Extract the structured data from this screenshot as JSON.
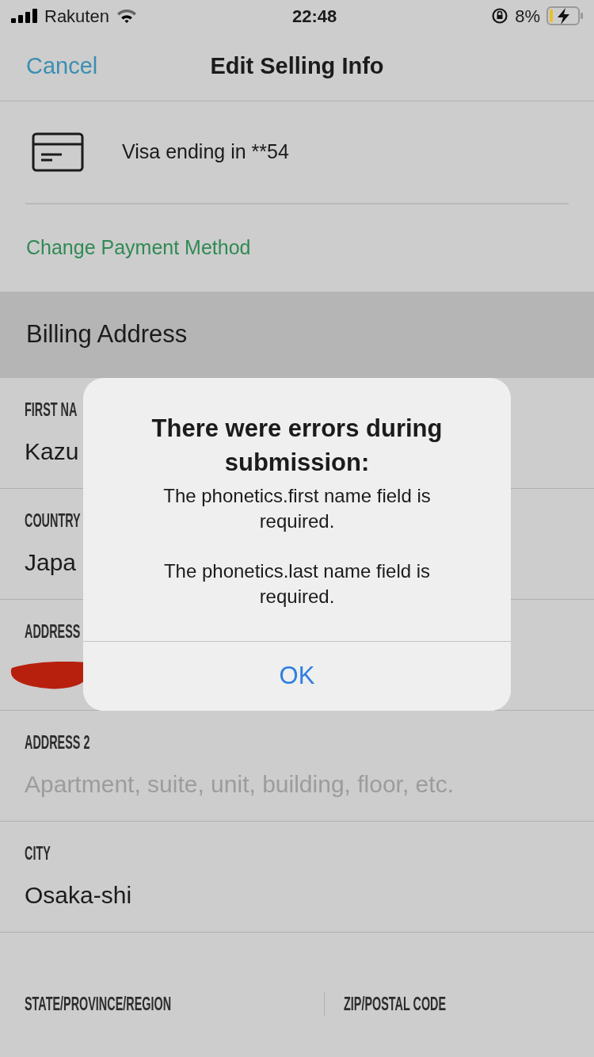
{
  "status_bar": {
    "carrier": "Rakuten",
    "time": "22:48",
    "battery": "8%"
  },
  "nav": {
    "cancel": "Cancel",
    "title": "Edit Selling Info"
  },
  "payment": {
    "card": "Visa ending in **54",
    "change_link": "Change Payment Method"
  },
  "section": {
    "title": "Billing Address"
  },
  "fields": [
    {
      "kind": "value",
      "label": "FIRST NA",
      "value": "Kazu"
    },
    {
      "kind": "value",
      "label": "COUNTRY",
      "value": "Japa"
    },
    {
      "kind": "redacted",
      "label": "ADDRESS"
    },
    {
      "kind": "placeholder",
      "label": "ADDRESS 2",
      "placeholder": "Apartment, suite, unit, building, floor, etc."
    },
    {
      "kind": "value",
      "label": "CITY",
      "value": "Osaka-shi"
    }
  ],
  "split_fields": [
    {
      "label": "STATE/PROVINCE/REGION"
    },
    {
      "label": "ZIP/POSTAL CODE"
    }
  ],
  "dialog": {
    "title": "There were errors during submission:",
    "messages": [
      "The phonetics.first name field is required.",
      "The phonetics.last name field is required."
    ],
    "button": "OK"
  }
}
